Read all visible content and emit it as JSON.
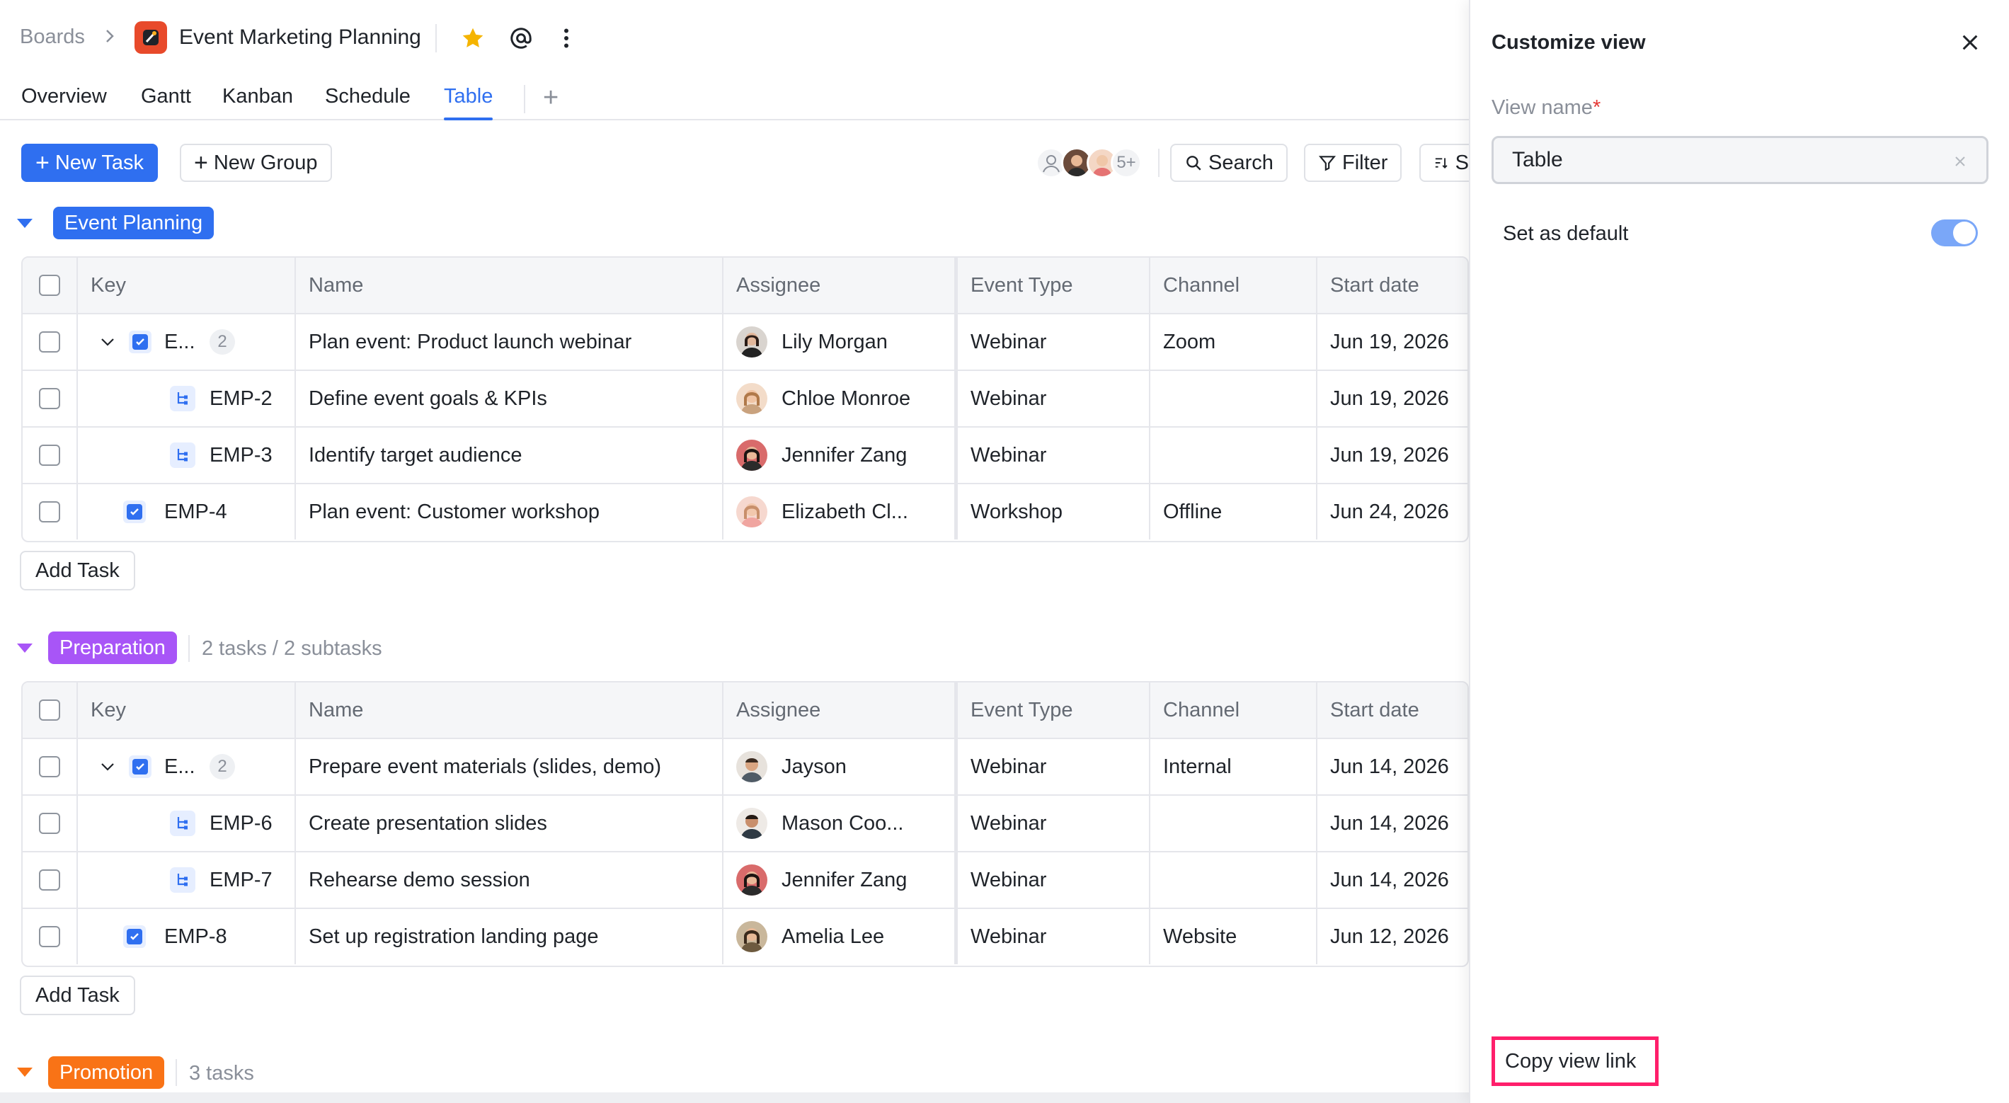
{
  "breadcrumb": {
    "root": "Boards",
    "board_title": "Event Marketing Planning"
  },
  "tabs": [
    {
      "label": "Overview"
    },
    {
      "label": "Gantt"
    },
    {
      "label": "Kanban"
    },
    {
      "label": "Schedule"
    },
    {
      "label": "Table",
      "active": true
    }
  ],
  "toolbar": {
    "new_task": "New Task",
    "new_group": "New Group",
    "members_more": "5+",
    "search": "Search",
    "filter": "Filter",
    "sort_partial": "S"
  },
  "columns": [
    "Key",
    "Name",
    "Assignee",
    "Event Type",
    "Channel",
    "Start date"
  ],
  "groups": [
    {
      "name": "Event Planning",
      "color": "#2f6ff0",
      "meta": "",
      "rows": [
        {
          "type": "parent",
          "key": "E...",
          "subtasks": "2",
          "name": "Plan event: Product launch webinar",
          "assignee": "Lily Morgan",
          "event_type": "Webinar",
          "channel": "Zoom",
          "start": "Jun 19, 2026"
        },
        {
          "type": "sub",
          "key": "EMP-2",
          "name": "Define event goals & KPIs",
          "assignee": "Chloe Monroe",
          "event_type": "Webinar",
          "channel": "",
          "start": "Jun 19, 2026"
        },
        {
          "type": "sub",
          "key": "EMP-3",
          "name": "Identify target audience",
          "assignee": "Jennifer Zang",
          "event_type": "Webinar",
          "channel": "",
          "start": "Jun 19, 2026"
        },
        {
          "type": "task",
          "key": "EMP-4",
          "name": "Plan event: Customer workshop",
          "assignee": "Elizabeth Cl...",
          "event_type": "Workshop",
          "channel": "Offline",
          "start": "Jun 24, 2026"
        }
      ],
      "add_task": "Add Task"
    },
    {
      "name": "Preparation",
      "color": "#a855f7",
      "meta": "2 tasks / 2 subtasks",
      "rows": [
        {
          "type": "parent",
          "key": "E...",
          "subtasks": "2",
          "name": "Prepare event materials (slides, demo)",
          "assignee": "Jayson",
          "event_type": "Webinar",
          "channel": "Internal",
          "start": "Jun 14, 2026"
        },
        {
          "type": "sub",
          "key": "EMP-6",
          "name": "Create presentation slides",
          "assignee": "Mason Coo...",
          "event_type": "Webinar",
          "channel": "",
          "start": "Jun 14, 2026"
        },
        {
          "type": "sub",
          "key": "EMP-7",
          "name": "Rehearse demo session",
          "assignee": "Jennifer Zang",
          "event_type": "Webinar",
          "channel": "",
          "start": "Jun 14, 2026"
        },
        {
          "type": "task",
          "key": "EMP-8",
          "name": "Set up registration landing page",
          "assignee": "Amelia Lee",
          "event_type": "Webinar",
          "channel": "Website",
          "start": "Jun 12, 2026"
        }
      ],
      "add_task": "Add Task"
    },
    {
      "name": "Promotion",
      "color": "#f97316",
      "meta": "3 tasks",
      "rows": []
    }
  ],
  "panel": {
    "title": "Customize view",
    "view_name_label": "View name",
    "required_mark": "*",
    "view_name_value": "Table",
    "set_default_label": "Set as default",
    "set_default_on": true,
    "copy_link": "Copy view link"
  }
}
